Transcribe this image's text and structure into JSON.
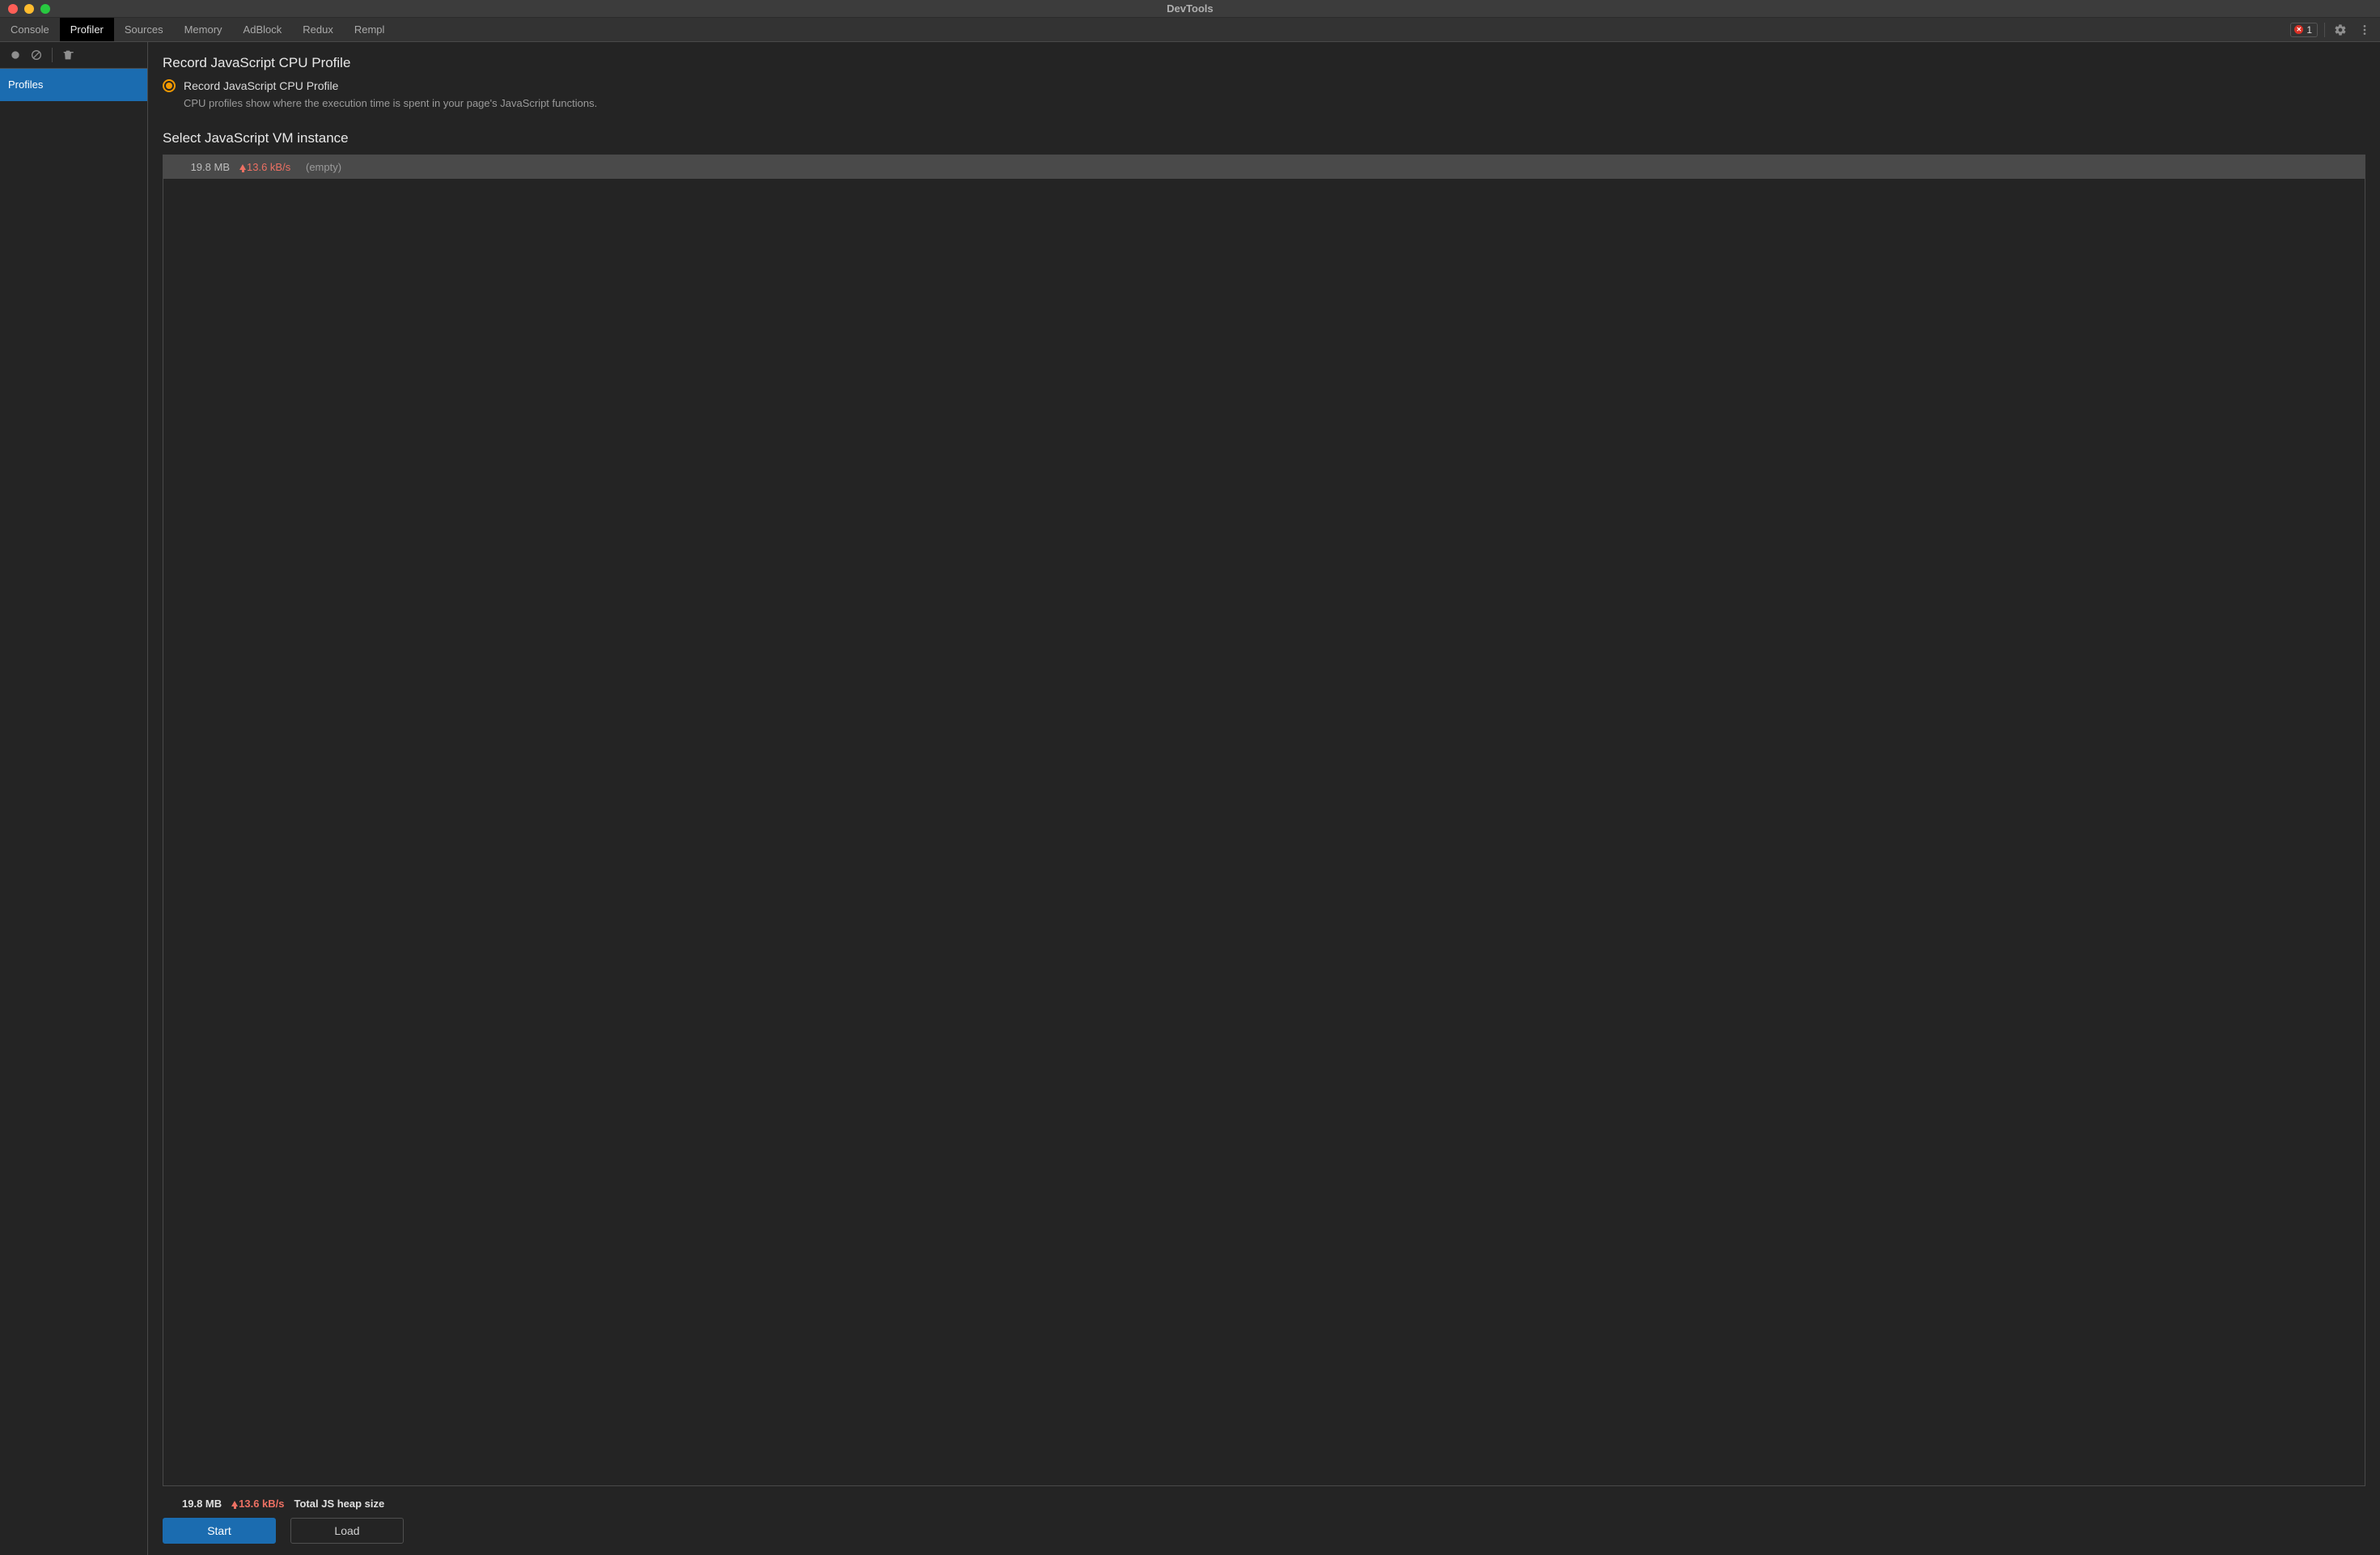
{
  "window": {
    "title": "DevTools"
  },
  "tabs": [
    {
      "label": "Console",
      "active": false
    },
    {
      "label": "Profiler",
      "active": true
    },
    {
      "label": "Sources",
      "active": false
    },
    {
      "label": "Memory",
      "active": false
    },
    {
      "label": "AdBlock",
      "active": false
    },
    {
      "label": "Redux",
      "active": false
    },
    {
      "label": "Rempl",
      "active": false
    }
  ],
  "toolbar_right": {
    "error_count": "1"
  },
  "sidebar": {
    "items": [
      {
        "label": "Profiles",
        "selected": true
      }
    ]
  },
  "profiler": {
    "section1_title": "Record JavaScript CPU Profile",
    "radio_label": "Record JavaScript CPU Profile",
    "radio_desc": "CPU profiles show where the execution time is spent in your page's JavaScript functions.",
    "section2_title": "Select JavaScript VM instance",
    "vm_instances": [
      {
        "heap": "19.8 MB",
        "rate": "13.6 kB/s",
        "name": "(empty)"
      }
    ],
    "footer": {
      "heap": "19.8 MB",
      "rate": "13.6 kB/s",
      "label": "Total JS heap size"
    },
    "buttons": {
      "start": "Start",
      "load": "Load"
    }
  }
}
